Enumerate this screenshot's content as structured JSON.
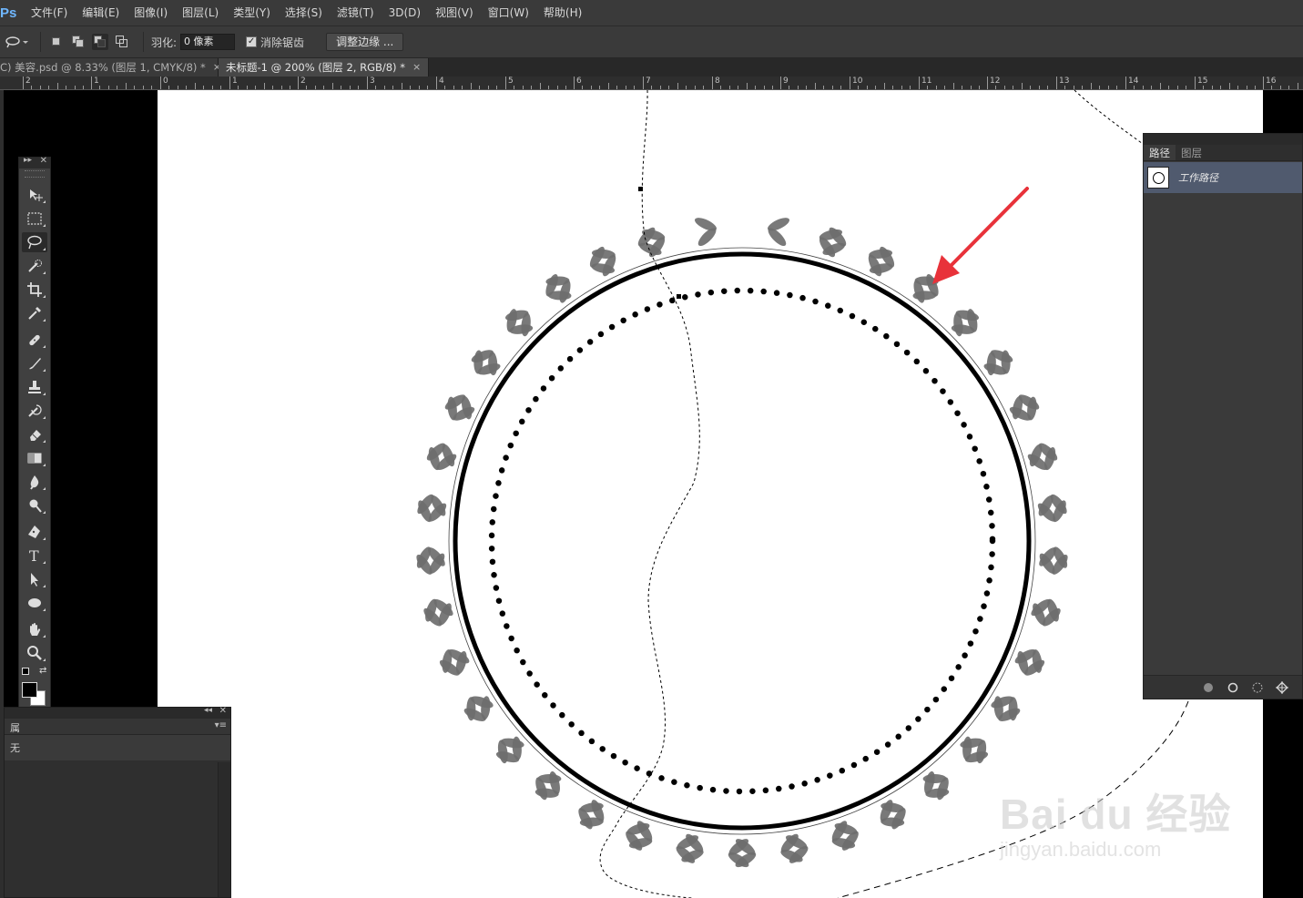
{
  "app": {
    "logo": "Ps",
    "menu": [
      "文件(F)",
      "编辑(E)",
      "图像(I)",
      "图层(L)",
      "类型(Y)",
      "选择(S)",
      "滤镜(T)",
      "3D(D)",
      "视图(V)",
      "窗口(W)",
      "帮助(H)"
    ]
  },
  "options": {
    "tool_icon": "lasso-icon",
    "feather_label": "羽化:",
    "feather_value": "0 像素",
    "antialias_label": "消除锯齿",
    "antialias_checked": true,
    "refine_edge_label": "调整边缘 ..."
  },
  "tabs": [
    {
      "label": "C) 美容.psd @ 8.33% (图层 1, CMYK/8) *",
      "close": "×",
      "active": false
    },
    {
      "label": "未标题-1 @ 200% (图层 2, RGB/8) *",
      "close": "×",
      "active": true
    }
  ],
  "ruler": {
    "labels": [
      "2",
      "1",
      "0",
      "1",
      "2",
      "3",
      "4",
      "5",
      "6",
      "7",
      "8",
      "9",
      "10",
      "11",
      "12",
      "13",
      "14",
      "15",
      "16"
    ]
  },
  "toolbox": {
    "tools": [
      {
        "name": "move-tool",
        "icon": "move-icon"
      },
      {
        "name": "marquee-tool",
        "icon": "rect-marquee-icon"
      },
      {
        "name": "lasso-tool",
        "icon": "lasso-icon",
        "active": true
      },
      {
        "name": "quick-select-tool",
        "icon": "quick-select-icon"
      },
      {
        "name": "crop-tool",
        "icon": "crop-icon"
      },
      {
        "name": "eyedropper-tool",
        "icon": "eyedropper-icon"
      },
      {
        "name": "healing-tool",
        "icon": "bandage-icon"
      },
      {
        "name": "brush-tool",
        "icon": "brush-icon"
      },
      {
        "name": "stamp-tool",
        "icon": "stamp-icon"
      },
      {
        "name": "history-brush-tool",
        "icon": "history-brush-icon"
      },
      {
        "name": "eraser-tool",
        "icon": "eraser-icon"
      },
      {
        "name": "gradient-tool",
        "icon": "gradient-icon"
      },
      {
        "name": "blur-tool",
        "icon": "blur-icon"
      },
      {
        "name": "dodge-tool",
        "icon": "dodge-icon"
      },
      {
        "name": "pen-tool",
        "icon": "pen-icon"
      },
      {
        "name": "type-tool",
        "icon": "type-icon",
        "glyph": "T"
      },
      {
        "name": "path-select-tool",
        "icon": "arrow-icon"
      },
      {
        "name": "ellipse-tool",
        "icon": "ellipse-icon"
      },
      {
        "name": "hand-tool",
        "icon": "hand-icon"
      },
      {
        "name": "zoom-tool",
        "icon": "zoom-icon"
      }
    ],
    "foreground_color": "#000000",
    "background_color": "#ffffff"
  },
  "paths_panel": {
    "tabs": [
      "路径",
      "图层"
    ],
    "active_tab": 0,
    "paths": [
      {
        "name": "工作路径"
      }
    ],
    "footer_icons": [
      "fill-path-icon",
      "stroke-path-icon",
      "load-selection-icon",
      "make-work-path-icon"
    ]
  },
  "bottom_panel": {
    "tab_label": "属",
    "sub_text": "无"
  },
  "watermark": {
    "text": "Bai du 经验",
    "url": "jingyan.baidu.com"
  },
  "colors": {
    "arrow": "#e8323a",
    "leaf": "#6e6e6e",
    "selection_panel_row": "#505a6e"
  }
}
